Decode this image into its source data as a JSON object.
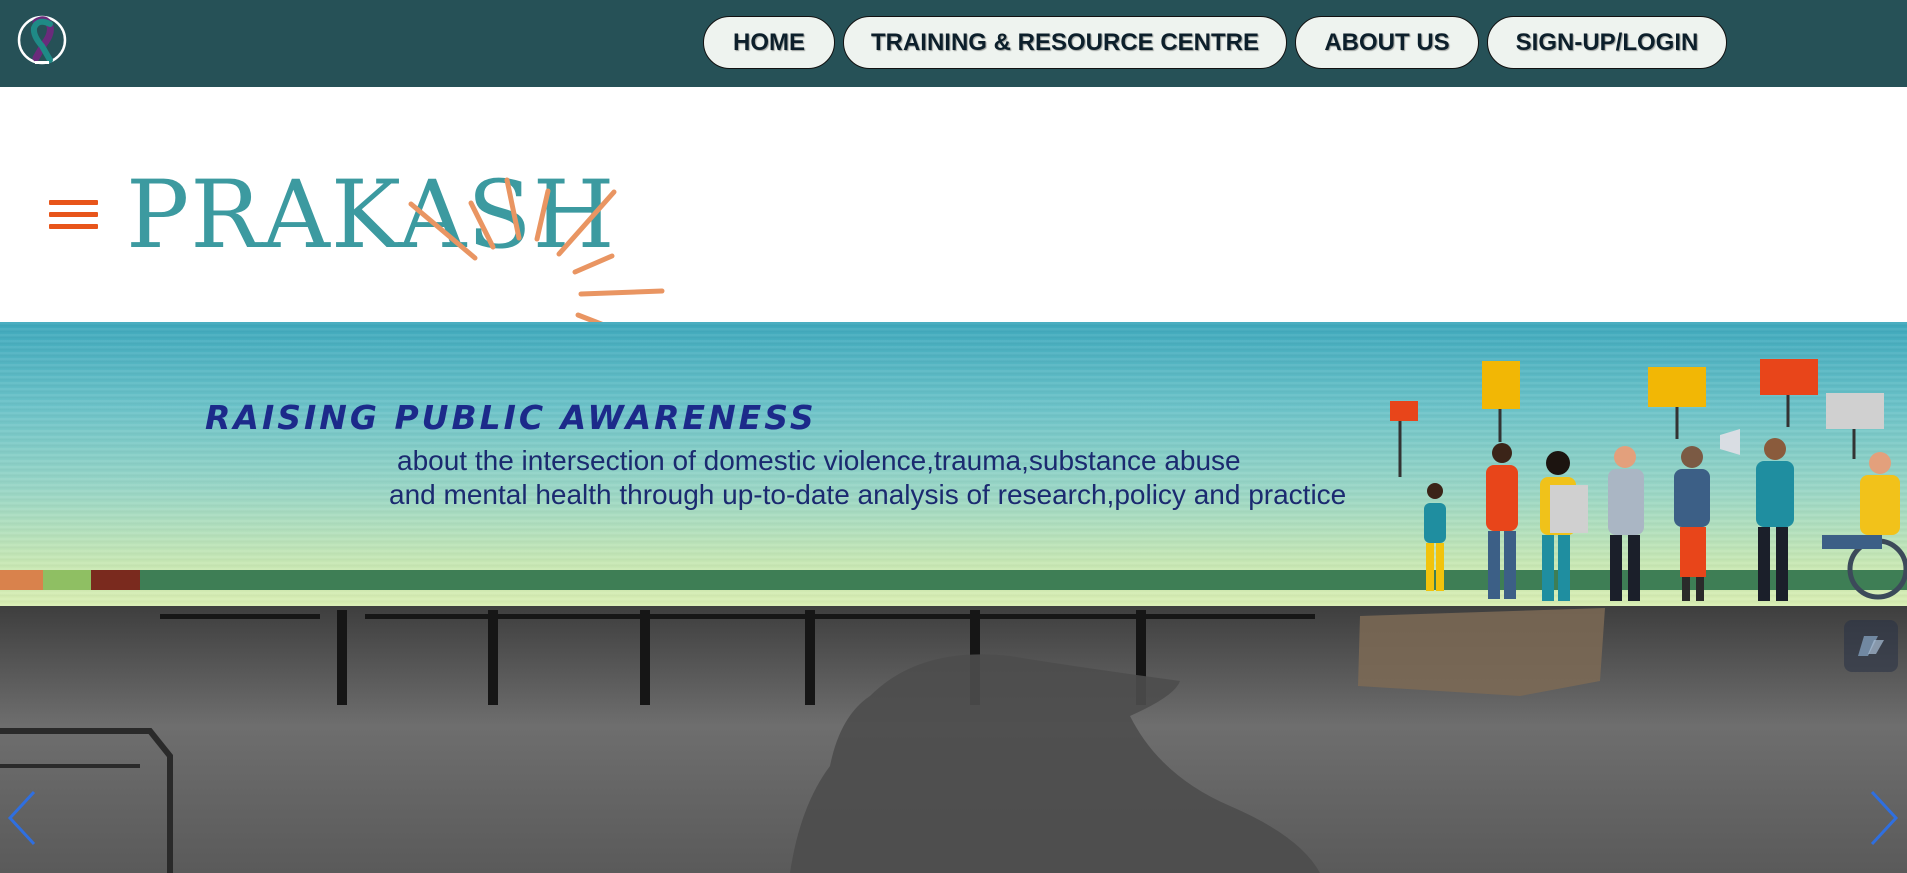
{
  "nav": {
    "items": [
      "HOME",
      "TRAINING & RESOURCE CENTRE",
      "ABOUT US",
      "SIGN-UP/LOGIN"
    ]
  },
  "header": {
    "brand": "PRAKASH"
  },
  "banner": {
    "title": "Raising public awareness",
    "line1": "about the intersection of domestic violence,trauma,substance abuse",
    "line2": "and mental health through up-to-date analysis of research,policy and practice"
  },
  "icons": {
    "ribbon": "awareness-ribbon-icon",
    "menu": "hamburger-menu-icon",
    "prev": "chevron-left-icon",
    "next": "chevron-right-icon",
    "widget": "slash-widget-icon"
  },
  "colors": {
    "topbar": "#265157",
    "brand": "#3c9aa0",
    "accent": "#e8551a",
    "sun": "#e99562",
    "banner_text": "#1c2a8a",
    "arrow": "#2f6fe0"
  }
}
